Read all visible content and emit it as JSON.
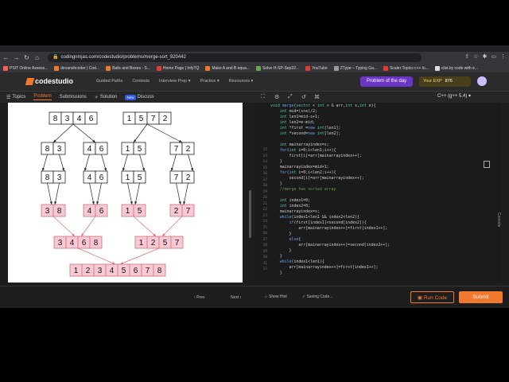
{
  "browser": {
    "url": "codingninjas.com/codestudio/problems/merge-sort_920442",
    "bookmarks": [
      {
        "label": "PSIT Online Assess...",
        "color": "#ff5d5d"
      },
      {
        "label": "devanshcoder | Cod...",
        "color": "#f0792e"
      },
      {
        "label": "Balls and Boxes - S...",
        "color": "#f0792e"
      },
      {
        "label": "Home Page | InfyTQ",
        "color": "#e53935"
      },
      {
        "label": "Make A and B equa...",
        "color": "#f0792e"
      },
      {
        "label": "Solve H-SP-Sep22...",
        "color": "#6aa84f"
      },
      {
        "label": "YouTube",
        "color": "#e53935"
      },
      {
        "label": "ZType – Typing Ga...",
        "color": "#999999"
      },
      {
        "label": "Scaler Topics c++ lo...",
        "color": "#e53935"
      },
      {
        "label": "clist.by code with e...",
        "color": "#dddddd"
      }
    ]
  },
  "header": {
    "logo": "codestudio",
    "nav": [
      "Guided Paths",
      "Contests",
      "Interview Prep",
      "Practice",
      "Resources"
    ],
    "potd": "Problem of the day",
    "exp_label": "Your EXP",
    "exp_value": "876"
  },
  "tabs": {
    "topics": "Topics",
    "problem": "Problem",
    "submissions": "Submissions",
    "solution": "Solution",
    "new_badge": "New",
    "discuss": "Discuss"
  },
  "editor": {
    "language": "C++ (g++ 5.4)",
    "console": "Console",
    "line_numbers": [
      "12",
      "13",
      "14",
      "15",
      "16",
      "17",
      "18",
      "19",
      "20",
      "21",
      "22",
      "23",
      "24",
      "25",
      "26",
      "27",
      "28",
      "29",
      "30",
      "31",
      "32"
    ]
  },
  "diagram": {
    "level0": [
      [
        "8",
        "3",
        "4",
        "6"
      ],
      [
        "1",
        "5",
        "7",
        "2"
      ]
    ],
    "level1": [
      [
        "8",
        "3"
      ],
      [
        "4",
        "6"
      ],
      [
        "1",
        "5"
      ],
      [
        "7",
        "2"
      ]
    ],
    "level2": [
      [
        "8",
        "3"
      ],
      [
        "4",
        "6"
      ],
      [
        "1",
        "5"
      ],
      [
        "7",
        "2"
      ]
    ],
    "level3": [
      [
        "3",
        "8"
      ],
      [
        "4",
        "6"
      ],
      [
        "1",
        "5"
      ],
      [
        "2",
        "7"
      ]
    ],
    "level4": [
      [
        "3",
        "4",
        "6",
        "8"
      ],
      [
        "1",
        "2",
        "5",
        "7"
      ]
    ],
    "level5": [
      "1",
      "2",
      "3",
      "4",
      "5",
      "6",
      "7",
      "8"
    ],
    "colors": {
      "white": "#ffffff",
      "pink": "#f8c8d4",
      "arrow": "#e07070"
    }
  },
  "footer": {
    "prev": "Prev",
    "next": "Next",
    "show_hint": "Show Hint",
    "saving": "Saving Code...",
    "run": "Run Code",
    "submit": "Submit"
  }
}
